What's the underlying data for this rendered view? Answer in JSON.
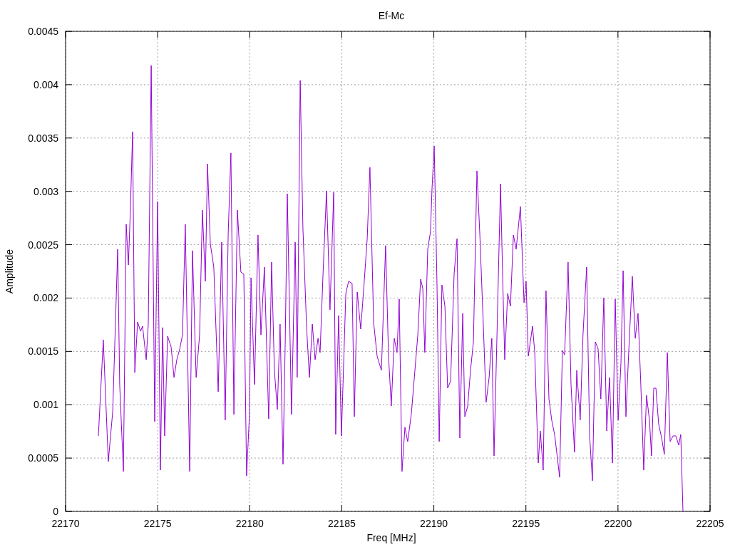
{
  "chart_data": {
    "type": "line",
    "grid": true,
    "title": "Ef-Mc",
    "xlabel": "Freq [MHz]",
    "ylabel": "Amplitude",
    "xlim": [
      22170,
      22205
    ],
    "ylim": [
      0,
      0.0045
    ],
    "xticks": [
      22170,
      22175,
      22180,
      22185,
      22190,
      22195,
      22200,
      22205
    ],
    "yticks": [
      {
        "value": 0,
        "label": "0"
      },
      {
        "value": 0.0005,
        "label": "0.0005"
      },
      {
        "value": 0.001,
        "label": "0.001"
      },
      {
        "value": 0.0015,
        "label": "0.0015"
      },
      {
        "value": 0.002,
        "label": "0.002"
      },
      {
        "value": 0.0025,
        "label": "0.0025"
      },
      {
        "value": 0.003,
        "label": "0.003"
      },
      {
        "value": 0.0035,
        "label": "0.0035"
      },
      {
        "value": 0.004,
        "label": "0.004"
      },
      {
        "value": 0.0045,
        "label": "0.0045"
      }
    ],
    "x": [
      22171.78,
      22172.05,
      22172.32,
      22172.56,
      22172.83,
      22172.94,
      22173.14,
      22173.29,
      22173.41,
      22173.52,
      22173.64,
      22173.76,
      22173.91,
      22174.07,
      22174.18,
      22174.38,
      22174.49,
      22174.65,
      22174.84,
      22175.0,
      22175.15,
      22175.27,
      22175.38,
      22175.54,
      22175.73,
      22175.89,
      22176.04,
      22176.2,
      22176.35,
      22176.5,
      22176.74,
      22176.89,
      22177.09,
      22177.28,
      22177.43,
      22177.59,
      22177.71,
      22177.86,
      22178.05,
      22178.29,
      22178.48,
      22178.67,
      22178.83,
      22178.98,
      22179.14,
      22179.33,
      22179.52,
      22179.68,
      22179.83,
      22179.99,
      22180.07,
      22180.26,
      22180.45,
      22180.61,
      22180.8,
      22181.03,
      22181.19,
      22181.34,
      22181.5,
      22181.65,
      22181.81,
      22181.93,
      22182.04,
      22182.27,
      22182.47,
      22182.58,
      22182.74,
      22182.89,
      22183.09,
      22183.24,
      22183.4,
      22183.55,
      22183.71,
      22183.82,
      22183.98,
      22184.17,
      22184.36,
      22184.56,
      22184.67,
      22184.83,
      22184.98,
      22185.22,
      22185.37,
      22185.56,
      22185.68,
      22185.84,
      22186.03,
      22186.18,
      22186.38,
      22186.53,
      22186.73,
      22186.92,
      22187.15,
      22187.38,
      22187.54,
      22187.69,
      22187.85,
      22188.0,
      22188.12,
      22188.27,
      22188.43,
      22188.58,
      22188.78,
      22188.97,
      22189.13,
      22189.28,
      22189.4,
      22189.51,
      22189.67,
      22189.82,
      22189.9,
      22190.02,
      22190.17,
      22190.29,
      22190.44,
      22190.6,
      22190.75,
      22190.91,
      22191.1,
      22191.26,
      22191.41,
      22191.57,
      22191.68,
      22191.84,
      22191.99,
      22192.15,
      22192.34,
      22192.5,
      22192.69,
      22192.84,
      22193.0,
      22193.15,
      22193.27,
      22193.42,
      22193.62,
      22193.73,
      22193.85,
      22194.01,
      22194.16,
      22194.32,
      22194.47,
      22194.7,
      22194.9,
      22195.01,
      22195.13,
      22195.24,
      22195.36,
      22195.48,
      22195.67,
      22195.78,
      22195.94,
      22196.09,
      22196.25,
      22196.4,
      22196.56,
      22196.83,
      22196.98,
      22197.1,
      22197.29,
      22197.45,
      22197.64,
      22197.76,
      22197.95,
      22198.1,
      22198.3,
      22198.46,
      22198.61,
      22198.77,
      22198.92,
      22199.07,
      22199.23,
      22199.39,
      22199.54,
      22199.7,
      22199.85,
      22200.01,
      22200.16,
      22200.28,
      22200.43,
      22200.59,
      22200.78,
      22200.94,
      22201.09,
      22201.24,
      22201.4,
      22201.55,
      22201.71,
      22201.82,
      22201.94,
      22202.06,
      22202.21,
      22202.37,
      22202.52,
      22202.68,
      22202.83,
      22202.99,
      22203.14,
      22203.3,
      22203.41,
      22203.53
    ],
    "series": [
      {
        "color": "#9400d3",
        "values": [
          0.000708,
          0.001609,
          0.000467,
          0.000935,
          0.002457,
          0.001189,
          0.000374,
          0.002691,
          0.00231,
          0.002824,
          0.003559,
          0.001302,
          0.001776,
          0.001689,
          0.001736,
          0.001422,
          0.001756,
          0.00418,
          0.000841,
          0.002904,
          0.000387,
          0.001723,
          0.000708,
          0.001643,
          0.001542,
          0.001255,
          0.001422,
          0.001522,
          0.001656,
          0.002691,
          0.000374,
          0.002444,
          0.001255,
          0.001656,
          0.002824,
          0.002157,
          0.003258,
          0.002511,
          0.00229,
          0.001122,
          0.002524,
          0.000855,
          0.002604,
          0.003359,
          0.000908,
          0.002824,
          0.002243,
          0.002223,
          0.000334,
          0.000921,
          0.00219,
          0.001189,
          0.002591,
          0.001656,
          0.00229,
          0.000868,
          0.002337,
          0.001322,
          0.000955,
          0.001756,
          0.000441,
          0.001589,
          0.002978,
          0.000908,
          0.002524,
          0.001255,
          0.00404,
          0.002657,
          0.001723,
          0.001255,
          0.001756,
          0.001422,
          0.001622,
          0.001489,
          0.002223,
          0.003005,
          0.00189,
          0.002991,
          0.000721,
          0.001836,
          0.000708,
          0.002043,
          0.002157,
          0.002137,
          0.000888,
          0.002057,
          0.001709,
          0.002057,
          0.002557,
          0.003225,
          0.001769,
          0.001456,
          0.001322,
          0.002491,
          0.001456,
          0.000988,
          0.001622,
          0.001489,
          0.00199,
          0.000374,
          0.000788,
          0.000654,
          0.000921,
          0.001322,
          0.001656,
          0.002177,
          0.00209,
          0.001489,
          0.002457,
          0.002624,
          0.003025,
          0.003425,
          0.002123,
          0.000654,
          0.002123,
          0.001923,
          0.001155,
          0.001222,
          0.002223,
          0.002557,
          0.000688,
          0.001856,
          0.000888,
          0.000988,
          0.001322,
          0.001589,
          0.003192,
          0.002591,
          0.001723,
          0.001022,
          0.001255,
          0.001622,
          0.000521,
          0.001589,
          0.003071,
          0.002257,
          0.001422,
          0.002043,
          0.001923,
          0.002591,
          0.002457,
          0.002858,
          0.001956,
          0.002157,
          0.001456,
          0.001589,
          0.001736,
          0.001489,
          0.000454,
          0.000754,
          0.000387,
          0.00207,
          0.001055,
          0.000855,
          0.000721,
          0.00032,
          0.001509,
          0.001469,
          0.002337,
          0.001189,
          0.000554,
          0.001322,
          0.000855,
          0.001656,
          0.00229,
          0.000708,
          0.000287,
          0.001589,
          0.001522,
          0.001055,
          0.002003,
          0.000754,
          0.001255,
          0.000454,
          0.00199,
          0.000855,
          0.001389,
          0.002257,
          0.000888,
          0.001522,
          0.002203,
          0.001622,
          0.001856,
          0.001189,
          0.000387,
          0.001088,
          0.000855,
          0.000521,
          0.001155,
          0.001155,
          0.000821,
          0.000688,
          0.000534,
          0.001489,
          0.000654,
          0.000708,
          0.000708,
          0.000621,
          0.000721,
          0
        ]
      }
    ]
  }
}
